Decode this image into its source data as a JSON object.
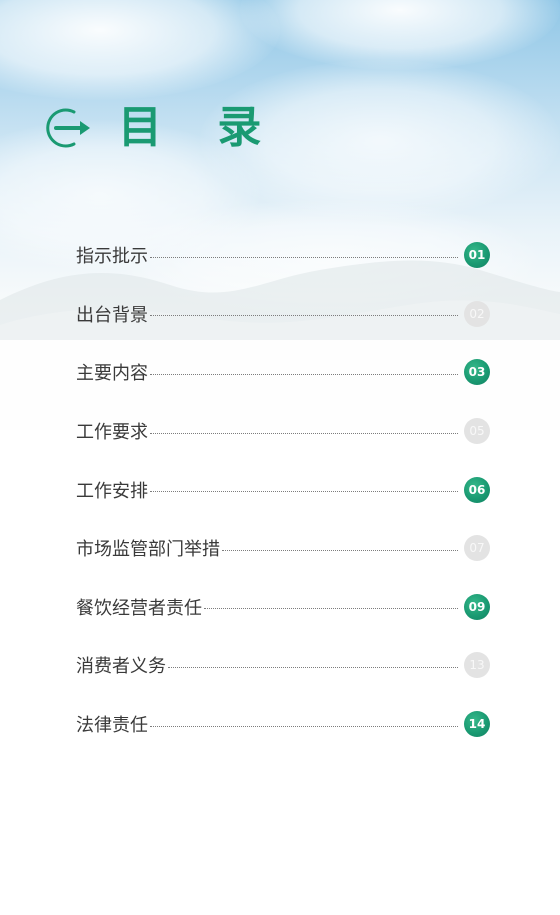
{
  "header": {
    "title": "目 录"
  },
  "colors": {
    "accent": "#1a9a72",
    "muted_badge": "#e3e3e3",
    "text": "#3a3a3a"
  },
  "toc": [
    {
      "label": "指示批示",
      "page": "01",
      "style": "green"
    },
    {
      "label": "出台背景",
      "page": "02",
      "style": "gray"
    },
    {
      "label": "主要内容",
      "page": "03",
      "style": "green"
    },
    {
      "label": "工作要求",
      "page": "05",
      "style": "gray"
    },
    {
      "label": "工作安排",
      "page": "06",
      "style": "green"
    },
    {
      "label": "市场监管部门举措",
      "page": "07",
      "style": "gray"
    },
    {
      "label": "餐饮经营者责任",
      "page": "09",
      "style": "green"
    },
    {
      "label": "消费者义务",
      "page": "13",
      "style": "gray"
    },
    {
      "label": "法律责任",
      "page": "14",
      "style": "green"
    }
  ]
}
